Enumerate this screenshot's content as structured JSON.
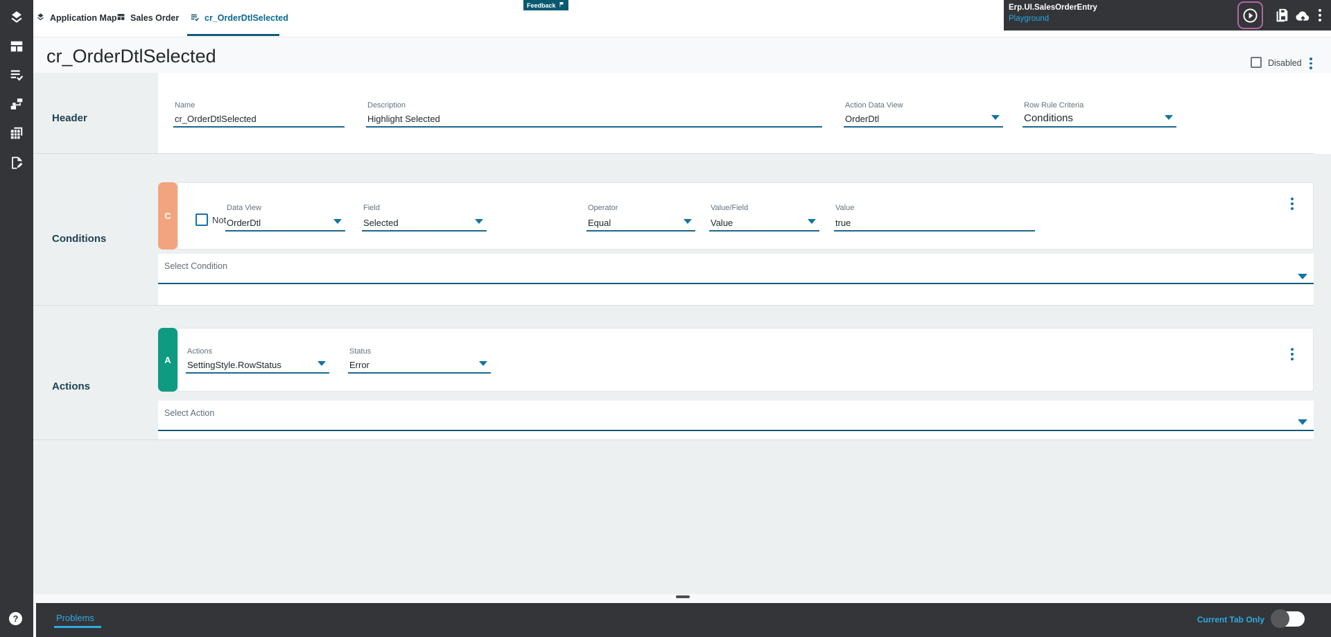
{
  "sidebar": {
    "help_glyph": "?"
  },
  "tabs": {
    "app_map": "Application Map",
    "sales_order": "Sales Order",
    "rule": "cr_OrderDtlSelected"
  },
  "feedback": {
    "label": "Feedback"
  },
  "app_info": {
    "title": "Erp.UI.SalesOrderEntry",
    "subtitle": "Playground"
  },
  "page": {
    "title": "cr_OrderDtlSelected",
    "disabled_label": "Disabled"
  },
  "header": {
    "label": "Header",
    "name_label": "Name",
    "name_value": "cr_OrderDtlSelected",
    "desc_label": "Description",
    "desc_value": "Highlight Selected",
    "adv_label": "Action Data View",
    "adv_value": "OrderDtl",
    "rrc_label": "Row Rule Criteria",
    "rrc_value": "Conditions"
  },
  "conditions": {
    "label": "Conditions",
    "badge": "C",
    "not_label": "Not",
    "dv_label": "Data View",
    "dv_value": "OrderDtl",
    "field_label": "Field",
    "field_value": "Selected",
    "op_label": "Operator",
    "op_value": "Equal",
    "vf_label": "Value/Field",
    "vf_value": "Value",
    "val_label": "Value",
    "val_value": "true",
    "select_placeholder": "Select Condition"
  },
  "actions": {
    "label": "Actions",
    "badge": "A",
    "actions_label": "Actions",
    "actions_value": "SettingStyle.RowStatus",
    "status_label": "Status",
    "status_value": "Error",
    "select_placeholder": "Select Action"
  },
  "bottom": {
    "problems_label": "Problems",
    "current_tab_label": "Current Tab Only"
  },
  "colors": {
    "accent_blue": "#1273a6",
    "active_tab_blue": "#0b6990",
    "link_blue": "#29a8df",
    "condition_badge": "#f2a47e",
    "action_badge": "#0e9b81",
    "dark_panel": "#333538",
    "feedback_teal": "#085870",
    "focus_ring_purple": "#b266a8"
  }
}
